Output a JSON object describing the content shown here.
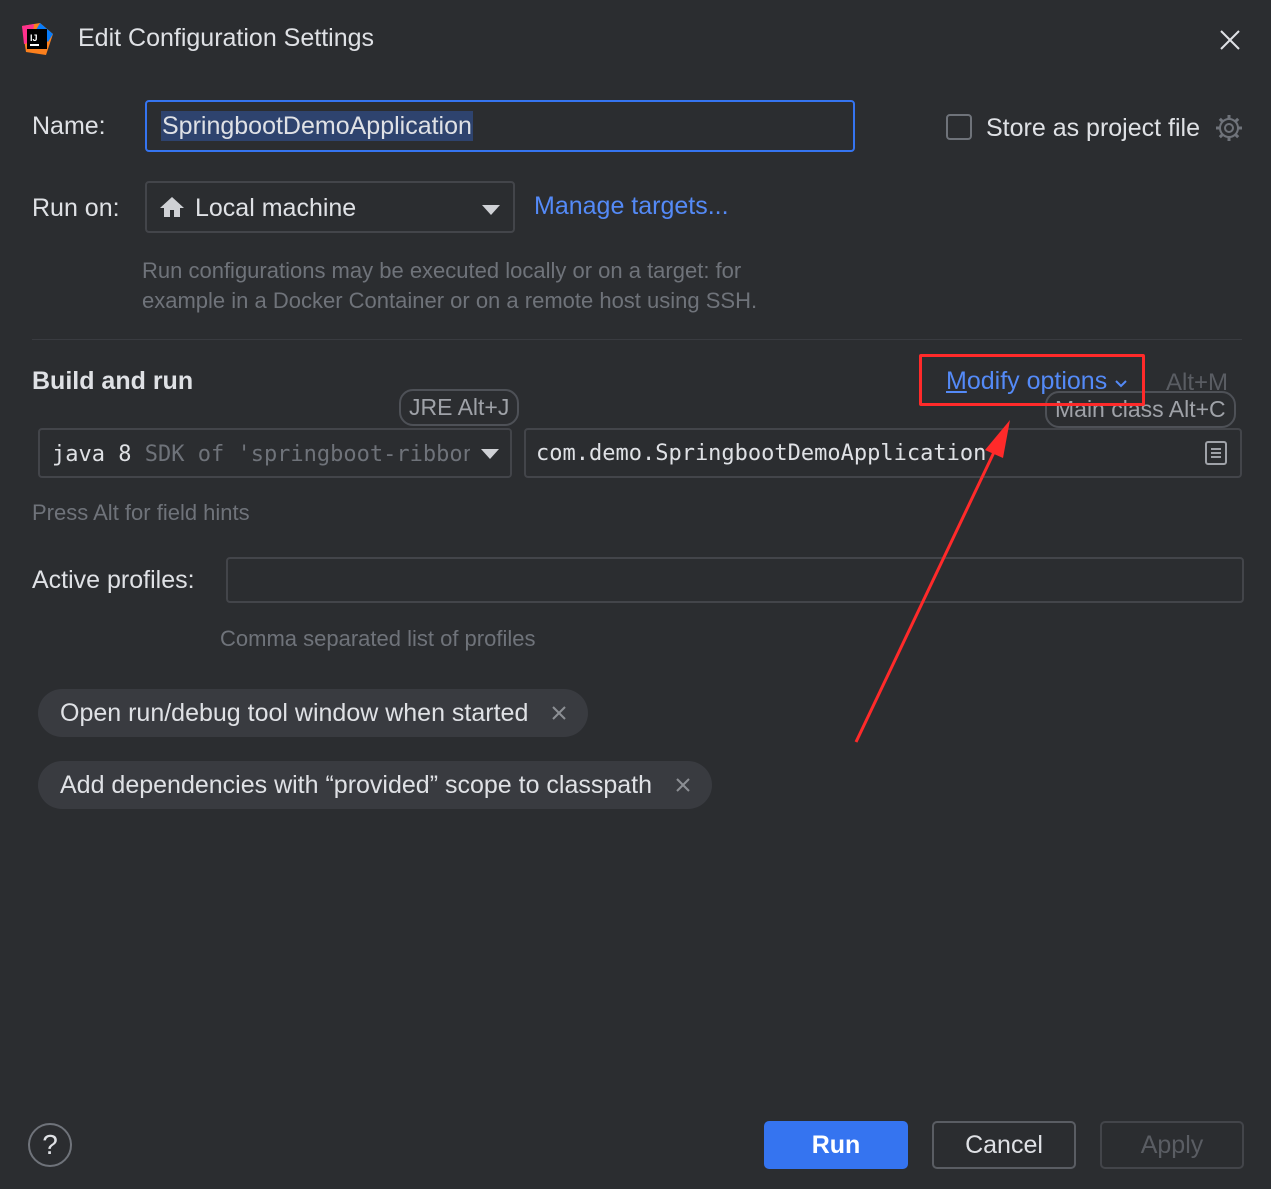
{
  "window": {
    "title": "Edit Configuration Settings",
    "logo_icon": "intellij-idea-logo-icon",
    "close_icon": "close-icon"
  },
  "name_field": {
    "label": "Name:",
    "value": "SpringbootDemoApplication"
  },
  "store_as_project_file": {
    "label": "Store as project file",
    "checked": false,
    "icon": "gear-icon"
  },
  "run_on": {
    "label": "Run on:",
    "selected": "Local machine",
    "icon": "home-icon",
    "manage_link": "Manage targets...",
    "hint_line1": "Run configurations may be executed locally or on a target: for",
    "hint_line2": "example in a Docker Container or on a remote host using SSH."
  },
  "build_and_run": {
    "title": "Build and run",
    "modify_options_prefix": "M",
    "modify_options_rest": "odify options",
    "modify_shortcut": "Alt+M",
    "jre_badge": "JRE Alt+J",
    "main_class_badge": "Main class Alt+C",
    "jre_version": "java 8",
    "jre_detail": "SDK of 'springboot-ribbon'",
    "main_class": "com.demo.SpringbootDemoApplication",
    "field_hint": "Press Alt for field hints"
  },
  "active_profiles": {
    "label": "Active profiles:",
    "value": "",
    "hint": "Comma separated list of profiles"
  },
  "options": [
    {
      "label": "Open run/debug tool window when started"
    },
    {
      "label": "Add dependencies with “provided” scope to classpath"
    }
  ],
  "footer": {
    "help": "?",
    "run": "Run",
    "cancel": "Cancel",
    "apply": "Apply"
  },
  "colors": {
    "background": "#2b2d30",
    "accent": "#3574f0",
    "link": "#548af7",
    "annotation": "#ff2a2a"
  }
}
